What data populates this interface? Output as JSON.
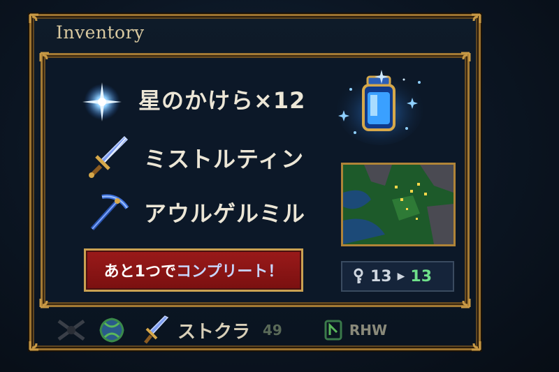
{
  "panel": {
    "title": "Inventory"
  },
  "items": [
    {
      "name": "星のかけら×12",
      "icon": "star-shard-icon"
    },
    {
      "name": "ミストルティン",
      "icon": "sword-icon"
    },
    {
      "name": "アウルゲルミル",
      "icon": "pickaxe-icon"
    }
  ],
  "preview": {
    "icon": "glowing-jar-icon"
  },
  "complete_button": {
    "prefix": "あと1つで",
    "highlight": "コンプリート！"
  },
  "map": {
    "icon": "minimap"
  },
  "counter": {
    "icon": "key-icon",
    "from": "13",
    "to": "13"
  },
  "bottom_bar": {
    "name": "ストクラ",
    "count": "49",
    "action": "RHW"
  },
  "colors": {
    "frame_gold": "#a37a35",
    "button_red": "#8a1414",
    "counter_green": "#6fe08a",
    "star_blue": "#6fb8ff"
  }
}
